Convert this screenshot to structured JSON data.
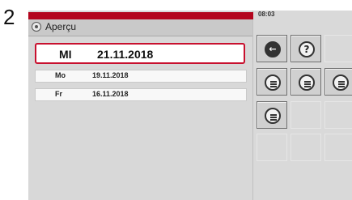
{
  "step_number": "2",
  "header": {
    "title": "Aperçu"
  },
  "selected_entry": {
    "day": "MI",
    "date": "21.11.2018"
  },
  "entries": [
    {
      "day": "Mo",
      "date": "19.11.2018"
    },
    {
      "day": "Fr",
      "date": "16.11.2018"
    }
  ],
  "panel": {
    "time": "08:03"
  },
  "buttons": {
    "back": {
      "icon": "back-arrow-icon",
      "glyph": "←"
    },
    "help": {
      "icon": "help-icon",
      "glyph": "?"
    },
    "list_a": {
      "icon": "list-settings-icon"
    },
    "list_b": {
      "icon": "list-settings-icon"
    },
    "list_c": {
      "icon": "list-settings-icon"
    },
    "list_d": {
      "icon": "list-settings-icon"
    }
  },
  "colors": {
    "accent_red": "#b3061e",
    "selection_border": "#c8102e",
    "panel_bg": "#d9d9d9"
  }
}
